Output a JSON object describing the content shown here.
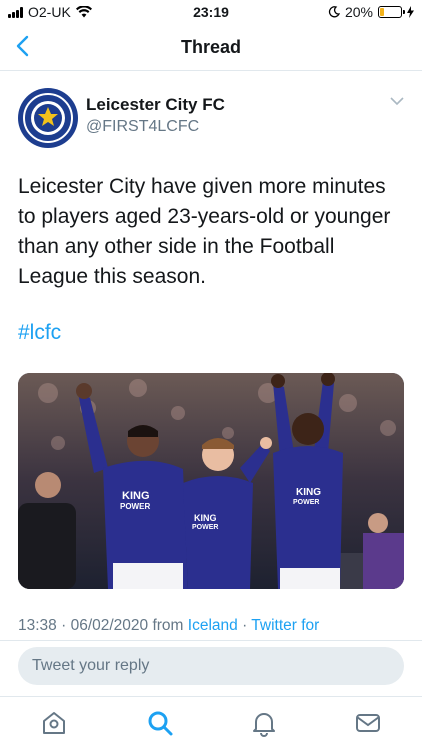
{
  "status_bar": {
    "carrier": "O2-UK",
    "time": "23:19",
    "battery": "20%",
    "battery_level": 0.2
  },
  "nav": {
    "title": "Thread"
  },
  "tweet": {
    "author_name": "Leicester City FC",
    "author_handle": "@FIRST4LCFC",
    "text": "Leicester City have given more minutes to players aged 23-years-old or younger than any other side in the Football League this season.",
    "hashtag": "#lcfc",
    "time": "13:38",
    "date": "06/02/2020",
    "from_label": "from",
    "location": "Iceland",
    "source": "Twitter for",
    "media_shirt_text": [
      "KING",
      "POWER"
    ]
  },
  "reply": {
    "placeholder": "Tweet your reply"
  },
  "tabs": [
    "home-icon",
    "search-icon",
    "notifications-icon",
    "messages-icon"
  ],
  "colors": {
    "accent": "#1da1f2",
    "kit": "#2b2f8f",
    "text": "#14171a",
    "muted": "#657786"
  }
}
